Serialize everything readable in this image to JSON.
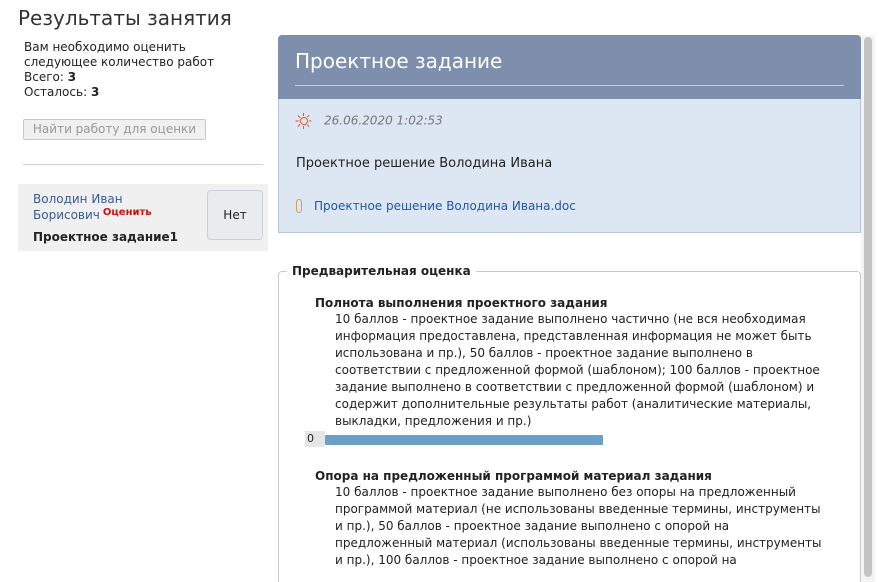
{
  "page": {
    "title": "Результаты занятия"
  },
  "sidebar": {
    "info_line1": "Вам необходимо оценить",
    "info_line2": "следующее количество работ",
    "total_label": "Всего:",
    "total_value": "3",
    "remaining_label": "Осталось:",
    "remaining_value": "3",
    "find_button": "Найти работу для оценки",
    "student": {
      "name_line1": "Володин Иван",
      "name_line2": "Борисович",
      "evaluate_link": "Оценить",
      "task": "Проектное задание1",
      "status_button": "Нет"
    }
  },
  "panel": {
    "title": "Проектное задание",
    "submission": {
      "date": "26.06.2020 1:02:53",
      "text": "Проектное решение Володина Ивана",
      "attachment": "Проектное решение Володина Ивана.doc"
    },
    "assessment": {
      "legend": "Предварительная оценка",
      "criteria": [
        {
          "title": "Полнота выполнения проектного задания",
          "lines": [
            "10 баллов - проектное задание выполнено частично (не вся необходимая",
            "информация предоставлена, представленная информация не может быть",
            "использована и пр.), 50 баллов - проектное задание выполнено в",
            "соответствии с предложенной формой (шаблоном); 100 баллов - проектное",
            "задание выполнено в соответствии с предложенной формой (шаблоном) и",
            "содержит дополнительные результаты работ (аналитические материалы,",
            "выкладки, предложения и пр.)"
          ],
          "score": "0"
        },
        {
          "title": "Опора на предложенный программой материал задания",
          "lines": [
            "10 баллов - проектное задание выполнено без опоры на предложенный",
            "программой материал (не использованы введенные термины, инструменты",
            "и пр.), 50 баллов - проектное задание выполнено с опорой на",
            "предложенный материал (использованы введенные термины, инструменты",
            "и пр.), 100 баллов - проектное задание выполнено с опорой на"
          ]
        }
      ]
    }
  },
  "icons": {
    "date_icon": "sun-icon",
    "attachment_icon": "paperclip-icon"
  },
  "colors": {
    "panel_header": "#7e8fad",
    "submission_bg": "#dde7f3",
    "link": "#1f57a4",
    "evaluate": "#cc1111",
    "slider": "#6e9fc6"
  }
}
